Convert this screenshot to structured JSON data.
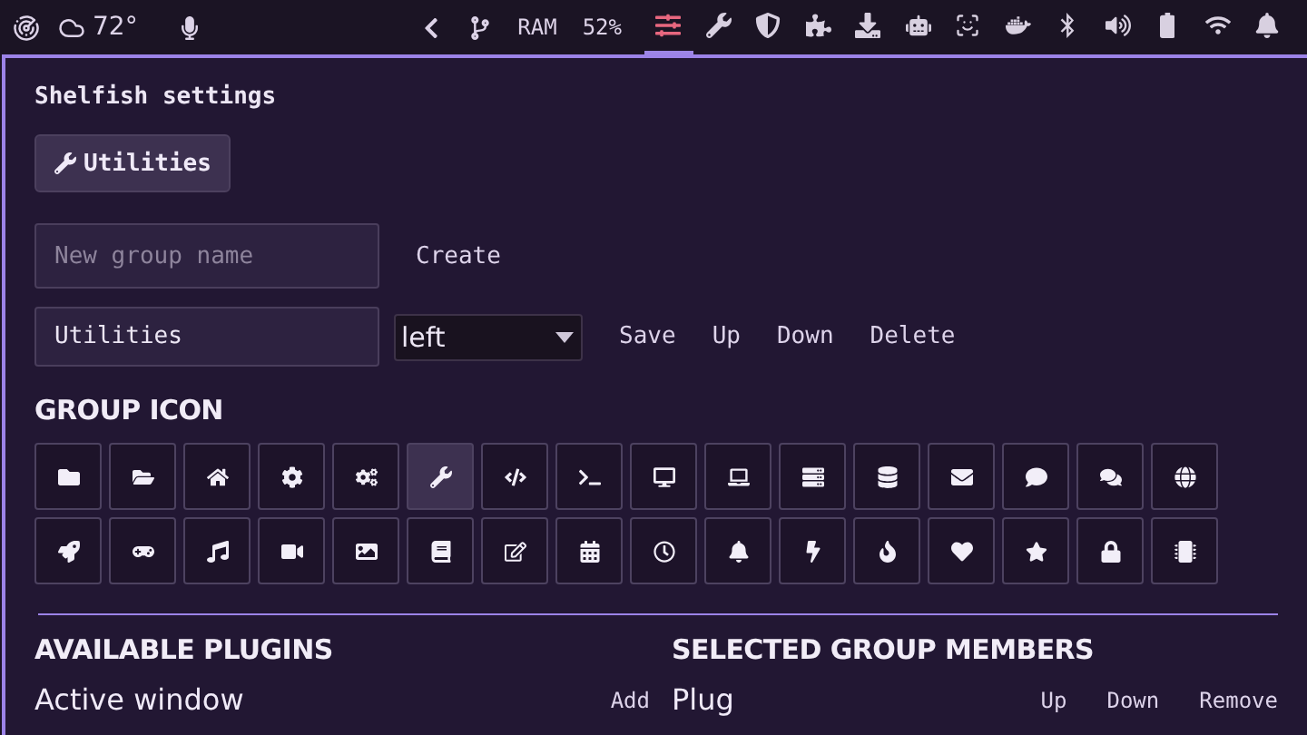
{
  "top_bar": {
    "weather": {
      "temperature": "72°"
    },
    "left_icons": [
      {
        "kind": "radar"
      },
      {
        "kind": "cloud"
      },
      {
        "kind": "mic"
      }
    ],
    "status": [
      {
        "kind": "back"
      },
      {
        "kind": "branch"
      }
    ],
    "ram": {
      "label": "RAM",
      "value": "52%"
    },
    "tray": [
      {
        "kind": "sliders",
        "selected": true
      },
      {
        "kind": "wrench",
        "selected": false
      },
      {
        "kind": "shield",
        "selected": false
      },
      {
        "kind": "puzzle",
        "selected": false
      },
      {
        "kind": "download",
        "selected": false
      },
      {
        "kind": "robot",
        "selected": false
      },
      {
        "kind": "scan",
        "selected": false
      },
      {
        "kind": "whale",
        "selected": false
      },
      {
        "kind": "bluetooth",
        "selected": false
      },
      {
        "kind": "volume",
        "selected": false
      },
      {
        "kind": "battery",
        "selected": false
      },
      {
        "kind": "wifi",
        "selected": false
      },
      {
        "kind": "bell",
        "selected": false
      }
    ]
  },
  "settings": {
    "title": "Shelfish settings",
    "groups": [
      {
        "label": "Utilities",
        "kind": "wrench",
        "selected": true
      }
    ],
    "new_group": {
      "placeholder": "New group name",
      "button": "Create"
    },
    "edit_group": {
      "value": "Utilities",
      "position": "left",
      "buttons": [
        "Save",
        "Up",
        "Down",
        "Delete"
      ]
    },
    "group_icon": {
      "heading": "GROUP ICON",
      "icons": [
        {
          "kind": "folder",
          "selected": false
        },
        {
          "kind": "folder-open",
          "selected": false
        },
        {
          "kind": "home",
          "selected": false
        },
        {
          "kind": "gear",
          "selected": false
        },
        {
          "kind": "gears",
          "selected": false
        },
        {
          "kind": "wrench",
          "selected": true
        },
        {
          "kind": "code",
          "selected": false
        },
        {
          "kind": "terminal",
          "selected": false
        },
        {
          "kind": "desktop",
          "selected": false
        },
        {
          "kind": "laptop",
          "selected": false
        },
        {
          "kind": "server",
          "selected": false
        },
        {
          "kind": "database",
          "selected": false
        },
        {
          "kind": "envelope",
          "selected": false
        },
        {
          "kind": "comment",
          "selected": false
        },
        {
          "kind": "comments",
          "selected": false
        },
        {
          "kind": "globe",
          "selected": false
        },
        {
          "kind": "rocket",
          "selected": false
        },
        {
          "kind": "gamepad",
          "selected": false
        },
        {
          "kind": "music",
          "selected": false
        },
        {
          "kind": "video",
          "selected": false
        },
        {
          "kind": "image",
          "selected": false
        },
        {
          "kind": "book",
          "selected": false
        },
        {
          "kind": "edit",
          "selected": false
        },
        {
          "kind": "calendar",
          "selected": false
        },
        {
          "kind": "clock",
          "selected": false
        },
        {
          "kind": "bell",
          "selected": false
        },
        {
          "kind": "bolt",
          "selected": false
        },
        {
          "kind": "fire",
          "selected": false
        },
        {
          "kind": "heart",
          "selected": false
        },
        {
          "kind": "star",
          "selected": false
        },
        {
          "kind": "lock",
          "selected": false
        },
        {
          "kind": "chip",
          "selected": false
        }
      ]
    },
    "available_plugins": {
      "heading": "AVAILABLE PLUGINS",
      "items": [
        {
          "name": "Active window",
          "action": "Add"
        }
      ]
    },
    "selected_members": {
      "heading": "SELECTED GROUP MEMBERS",
      "items": [
        {
          "name": "Plug",
          "actions": [
            "Up",
            "Down",
            "Remove"
          ]
        }
      ]
    }
  }
}
